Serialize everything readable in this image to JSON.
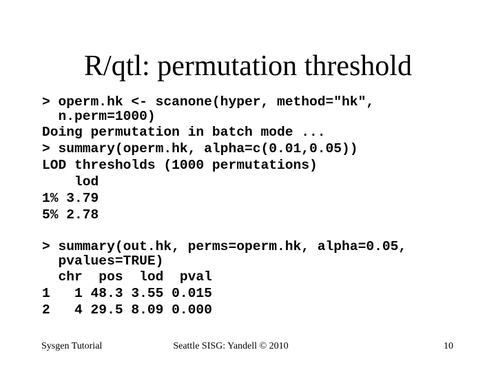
{
  "slide": {
    "title": "R/qtl: permutation threshold",
    "code_block_1": [
      "> operm.hk <- scanone(hyper, method=\"hk\",",
      "  n.perm=1000)",
      "Doing permutation in batch mode ...",
      "> summary(operm.hk, alpha=c(0.01,0.05))",
      "LOD thresholds (1000 permutations)",
      "    lod",
      "1% 3.79",
      "5% 2.78"
    ],
    "code_block_2": [
      "> summary(out.hk, perms=operm.hk, alpha=0.05,",
      "  pvalues=TRUE)",
      "  chr  pos  lod  pval",
      "1   1 48.3 3.55 0.015",
      "2   4 29.5 8.09 0.000"
    ],
    "thresholds": [
      {
        "alpha": "1%",
        "lod": 3.79
      },
      {
        "alpha": "5%",
        "lod": 2.78
      }
    ],
    "peaks": [
      {
        "row": "1",
        "chr": "1",
        "pos": 48.3,
        "lod": 3.55,
        "pval": 0.015
      },
      {
        "row": "2",
        "chr": "4",
        "pos": 29.5,
        "lod": 8.09,
        "pval": 0.0
      }
    ]
  },
  "footer": {
    "left": "Sysgen Tutorial",
    "center": "Seattle SISG: Yandell © 2010",
    "page_number": "10"
  }
}
